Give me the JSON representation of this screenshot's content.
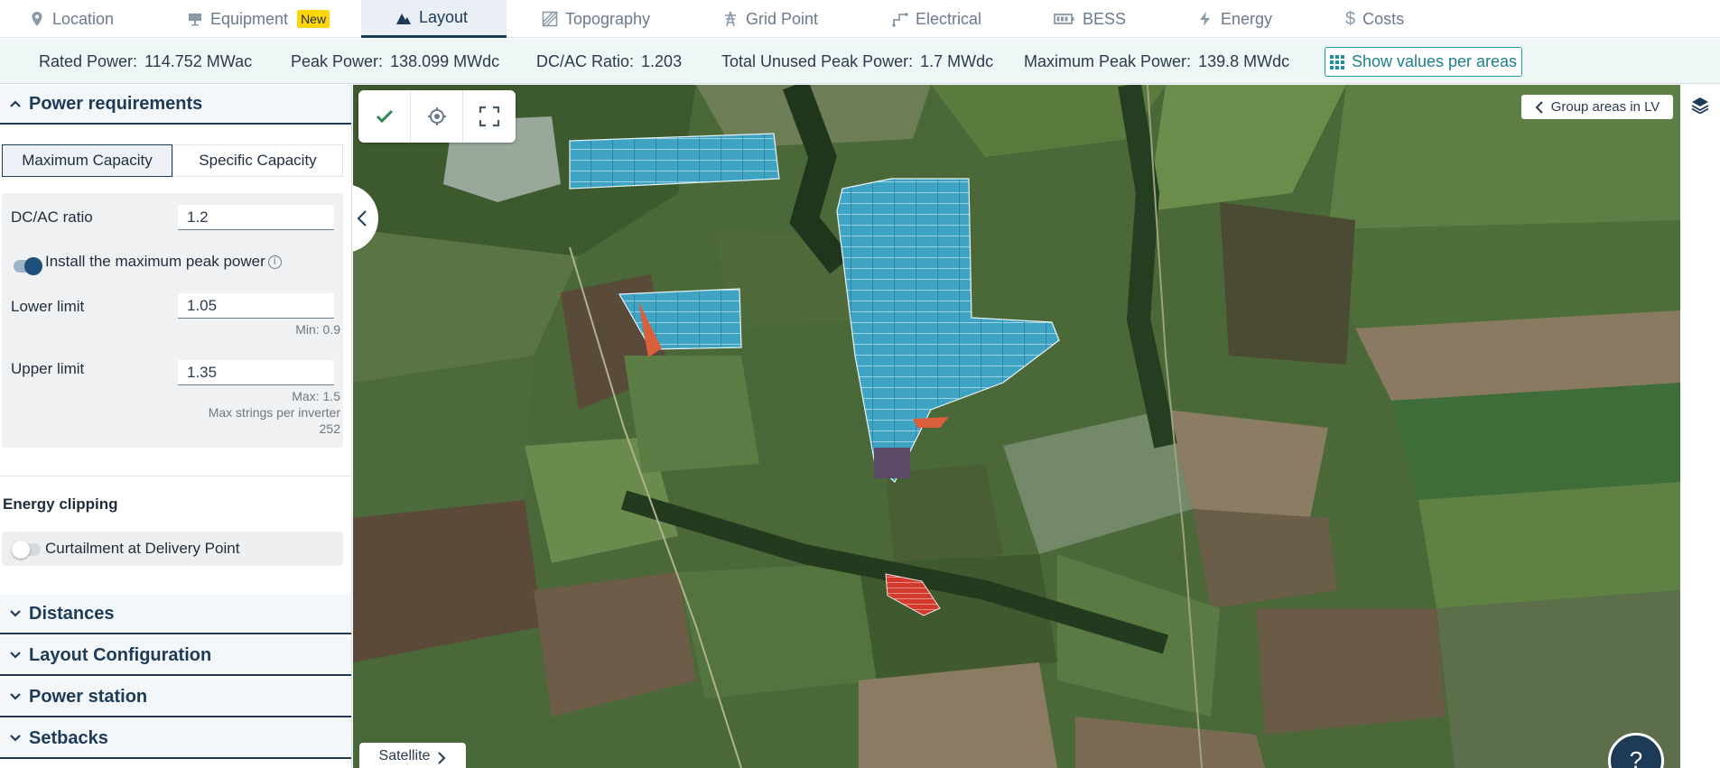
{
  "tabs": [
    {
      "label": "Location",
      "icon": "location-pin-icon"
    },
    {
      "label": "Equipment",
      "icon": "panel-icon",
      "badge": "New"
    },
    {
      "label": "Layout",
      "icon": "mountain-icon",
      "active": true
    },
    {
      "label": "Topography",
      "icon": "topography-icon"
    },
    {
      "label": "Grid Point",
      "icon": "grid-tower-icon"
    },
    {
      "label": "Electrical",
      "icon": "electrical-icon"
    },
    {
      "label": "BESS",
      "icon": "battery-icon"
    },
    {
      "label": "Energy",
      "icon": "bolt-icon"
    },
    {
      "label": "Costs",
      "icon": "dollar-icon"
    }
  ],
  "metrics": {
    "rated_power": {
      "label": "Rated Power:",
      "value": "114.752 MWac"
    },
    "peak_power": {
      "label": "Peak Power:",
      "value": "138.099 MWdc"
    },
    "dcac_ratio": {
      "label": "DC/AC Ratio:",
      "value": "1.203"
    },
    "unused_peak": {
      "label": "Total Unused Peak Power:",
      "value": "1.7 MWdc"
    },
    "max_peak": {
      "label": "Maximum Peak Power:",
      "value": "139.8 MWdc"
    },
    "areas_button": "Show values per areas"
  },
  "panel": {
    "power_requirements": {
      "title": "Power requirements",
      "segments": [
        "Maximum Capacity",
        "Specific Capacity"
      ],
      "selected_segment": "Maximum Capacity",
      "dcac_label": "DC/AC ratio",
      "dcac_value": "1.2",
      "install_max_label": "Install the maximum peak power",
      "install_max_on": true,
      "lower_label": "Lower limit",
      "lower_value": "1.05",
      "lower_hint": "Min: 0.9",
      "upper_label": "Upper limit",
      "upper_value": "1.35",
      "upper_hint_1": "Max: 1.5",
      "upper_hint_2": "Max strings per inverter",
      "upper_hint_3": "252"
    },
    "energy_clipping": {
      "title": "Energy clipping",
      "curtailment_label": "Curtailment at Delivery Point",
      "curtailment_on": false
    },
    "sections": [
      "Distances",
      "Layout Configuration",
      "Power station",
      "Setbacks"
    ]
  },
  "map": {
    "group_button": "Group areas in LV",
    "satellite_button": "Satellite",
    "help_label": "?",
    "colors": {
      "pv_area": "#3fa3c4",
      "exclusion": "#d9603b",
      "setback": "#d23a2e",
      "restricted": "#5a4a66"
    }
  }
}
